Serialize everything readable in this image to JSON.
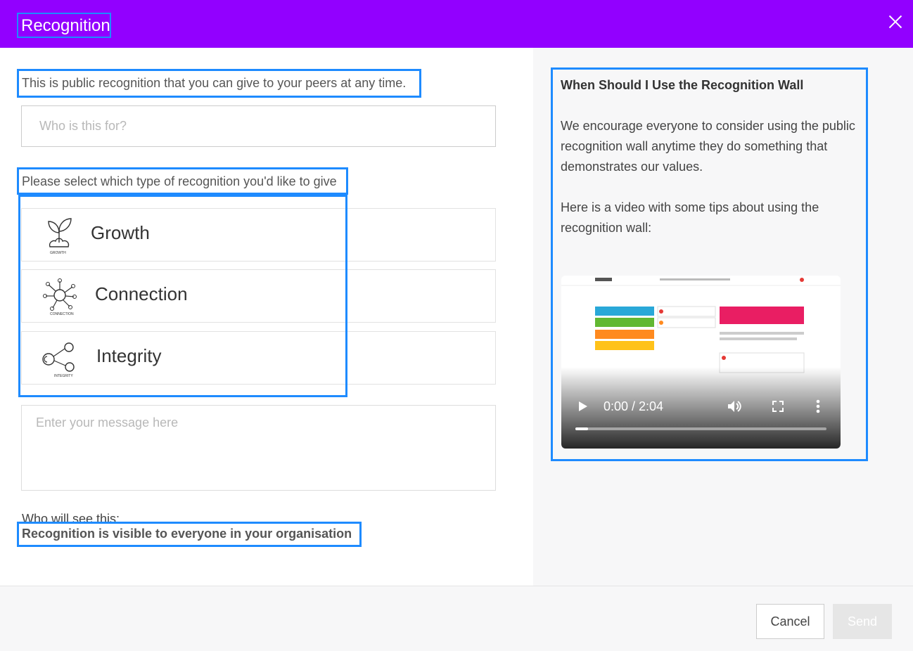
{
  "header": {
    "title": "Recognition",
    "close_icon": "close-icon",
    "bg_color": "#9200ff"
  },
  "form": {
    "intro": "This is public recognition that you can give to your peers at any time.",
    "recipient_placeholder": "Who is this for?",
    "select_label": "Please select which type of recognition you'd like to give",
    "types": [
      {
        "label": "Growth",
        "icon": "growth-icon",
        "icon_caption": "GROWTH"
      },
      {
        "label": "Connection",
        "icon": "connection-icon",
        "icon_caption": "CONNECTION"
      },
      {
        "label": "Integrity",
        "icon": "integrity-icon",
        "icon_caption": "INTEGRITY"
      }
    ],
    "message_placeholder": "Enter your message here",
    "who_will_see": "Who will see this:",
    "visibility": "Recognition is visible to everyone in your organisation"
  },
  "sidebar": {
    "heading": "When Should I Use the Recognition Wall",
    "paragraph1": "We encourage everyone to consider using the public recognition wall anytime they do something that demonstrates our values.",
    "paragraph2": "Here is a video with some tips about using the recognition wall:",
    "video": {
      "timecode": "0:00 / 2:04",
      "progress": 0.05
    }
  },
  "footer": {
    "cancel_label": "Cancel",
    "send_label": "Send"
  },
  "colors": {
    "accent": "#9200ff",
    "highlight": "#1e8bff"
  }
}
